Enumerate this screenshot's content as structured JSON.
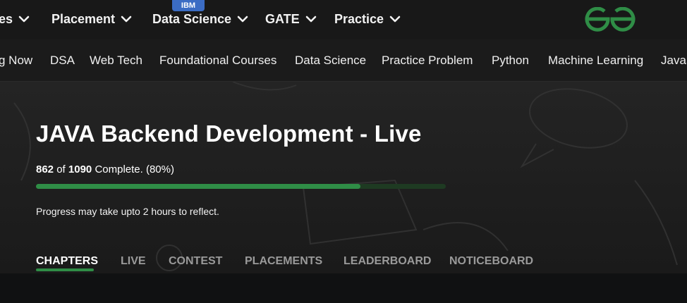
{
  "top_nav": {
    "items": [
      {
        "label": "es"
      },
      {
        "label": "Placement"
      },
      {
        "label": "Data Science"
      },
      {
        "label": "GATE"
      },
      {
        "label": "Practice"
      }
    ],
    "badge": "IBM",
    "brand_color": "#2f8d46"
  },
  "sub_nav": {
    "items": [
      "g Now",
      "DSA",
      "Web Tech",
      "Foundational Courses",
      "Data Science",
      "Practice Problem",
      "Python",
      "Machine Learning",
      "JavaS"
    ]
  },
  "course": {
    "title": "JAVA Backend Development - Live",
    "completed": "862",
    "of_word": "of",
    "total": "1090",
    "complete_text": "Complete. (80%)",
    "progress_fraction": 0.7909,
    "note": "Progress may take upto 2 hours to reflect."
  },
  "tabs": [
    {
      "label": "CHAPTERS",
      "active": true
    },
    {
      "label": "LIVE",
      "active": false
    },
    {
      "label": "CONTEST",
      "active": false
    },
    {
      "label": "PLACEMENTS",
      "active": false
    },
    {
      "label": "LEADERBOARD",
      "active": false
    },
    {
      "label": "NOTICEBOARD",
      "active": false
    }
  ],
  "icons": {
    "chevron": "chevron-down-icon",
    "logo": "geeksforgeeks-logo"
  }
}
